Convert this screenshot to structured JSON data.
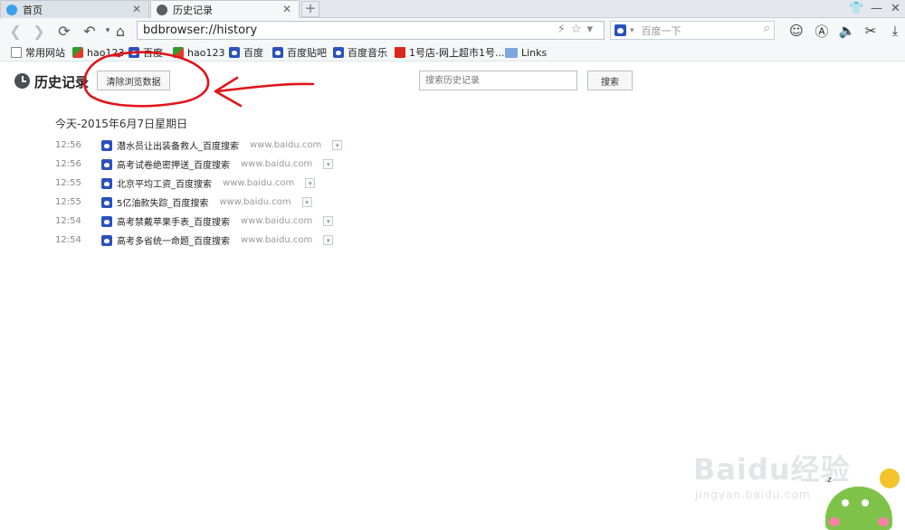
{
  "tabs": [
    {
      "label": "首页",
      "active": false
    },
    {
      "label": "历史记录",
      "active": true
    }
  ],
  "new_tab_label": "+",
  "window_tools": [
    "shirt-icon",
    "minimize-icon",
    "close-icon"
  ],
  "nav": {
    "back": "❮",
    "forward": "❯",
    "reload": "⟳",
    "undo": "↶",
    "home": "⌂"
  },
  "address": {
    "url": "bdbrowser://history",
    "icons": "⚡☆▾"
  },
  "search_engine": {
    "placeholder": "百度一下",
    "dropdown": "▾",
    "search_glyph": "⌕"
  },
  "toolbar_icons": [
    "☺",
    "Ⓐ",
    "🔈",
    "✂",
    "⤓"
  ],
  "bookmarks": [
    {
      "label": "常用网站",
      "icon": "page"
    },
    {
      "label": "hao123",
      "icon": "hao"
    },
    {
      "label": "百度",
      "icon": "paw"
    },
    {
      "label": "hao123",
      "icon": "hao"
    },
    {
      "label": "百度",
      "icon": "paw"
    },
    {
      "label": "百度贴吧",
      "icon": "paw"
    },
    {
      "label": "百度音乐",
      "icon": "paw"
    },
    {
      "label": "1号店-网上超市1号...",
      "icon": "yhd"
    },
    {
      "label": "Links",
      "icon": "folder"
    }
  ],
  "page": {
    "title": "历史记录",
    "clear_button": "清除浏览数据",
    "search_placeholder": "搜索历史记录",
    "search_button": "搜索"
  },
  "history": {
    "day": "今天-2015年6月7日星期日",
    "entries": [
      {
        "time": "12:56",
        "title": "潜水员让出装备救人_百度搜索",
        "domain": "www.baidu.com"
      },
      {
        "time": "12:56",
        "title": "高考试卷绝密押送_百度搜索",
        "domain": "www.baidu.com"
      },
      {
        "time": "12:55",
        "title": "北京平均工资_百度搜索",
        "domain": "www.baidu.com"
      },
      {
        "time": "12:55",
        "title": "5亿油款失踪_百度搜索",
        "domain": "www.baidu.com"
      },
      {
        "time": "12:54",
        "title": "高考禁戴苹果手表_百度搜索",
        "domain": "www.baidu.com"
      },
      {
        "time": "12:54",
        "title": "高考多省统一命题_百度搜索",
        "domain": "www.baidu.com"
      }
    ],
    "menu_glyph": "▾"
  },
  "watermark": {
    "logo": "Baidu经验",
    "url": "jingyan.baidu.com",
    "z": "z"
  },
  "colors": {
    "annotation": "#e0141a",
    "accent": "#2a52be"
  }
}
